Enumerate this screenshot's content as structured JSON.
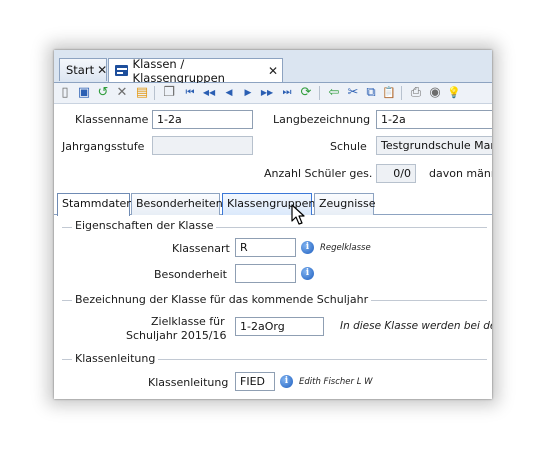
{
  "tabs": [
    {
      "label": "Start",
      "close": "✕"
    },
    {
      "label": "Klassen / Klassengruppen",
      "close": "✕"
    }
  ],
  "toolbar": [
    {
      "name": "new-icon",
      "glyph": "▯"
    },
    {
      "name": "save-icon",
      "glyph": "▣"
    },
    {
      "name": "undo-icon",
      "glyph": "↺"
    },
    {
      "name": "delete-icon",
      "glyph": "✕"
    },
    {
      "name": "form-icon",
      "glyph": "▤"
    },
    {
      "name": "copy-icon",
      "glyph": "❐"
    },
    {
      "name": "first-icon",
      "glyph": "⏮"
    },
    {
      "name": "prev-page-icon",
      "glyph": "◀◀"
    },
    {
      "name": "prev-icon",
      "glyph": "◀"
    },
    {
      "name": "next-icon",
      "glyph": "▶"
    },
    {
      "name": "next-page-icon",
      "glyph": "▶▶"
    },
    {
      "name": "last-icon",
      "glyph": "⏭"
    },
    {
      "name": "refresh-icon",
      "glyph": "⟳"
    },
    {
      "name": "back-arrow-icon",
      "glyph": "⇦"
    },
    {
      "name": "cut-icon",
      "glyph": "✂"
    },
    {
      "name": "copy2-icon",
      "glyph": "⧉"
    },
    {
      "name": "paste-icon",
      "glyph": "📋"
    },
    {
      "name": "print-icon",
      "glyph": "⎙"
    },
    {
      "name": "view-icon",
      "glyph": "◉"
    },
    {
      "name": "idea-icon",
      "glyph": "💡"
    }
  ],
  "form": {
    "klassenname_label": "Klassenname",
    "klassenname_value": "1-2a",
    "langbezeichnung_label": "Langbezeichnung",
    "langbezeichnung_value": "1-2a",
    "jahrgangsstufe_label": "Jahrgangsstufe",
    "jahrgangsstufe_value": "",
    "schule_label": "Schule",
    "schule_value": "Testgrundschule Mark",
    "anzahl_label": "Anzahl Schüler ges.",
    "anzahl_value": "0/0",
    "davon_label": "davon männ"
  },
  "inner_tabs": [
    "Stammdaten",
    "Besonderheiten",
    "Klassengruppen",
    "Zeugnisse"
  ],
  "eigenschaften": {
    "title": "Eigenschaften der Klasse",
    "klassenart_label": "Klassenart",
    "klassenart_value": "R",
    "klassenart_hint": "Regelklasse",
    "besonderheit_label": "Besonderheit",
    "besonderheit_value": ""
  },
  "bezeichnung": {
    "title": "Bezeichnung der Klasse für das kommende Schuljahr",
    "zielklasse_label_1": "Zielklasse für",
    "zielklasse_label_2": "Schuljahr 2015/16",
    "zielklasse_value": "1-2aOrg",
    "hint": "In diese Klasse werden bei der i"
  },
  "klassenleitung": {
    "title": "Klassenleitung",
    "label": "Klassenleitung",
    "value": "FIED",
    "hint": "Edith Fischer L W"
  },
  "colors": {
    "accent": "#1e4f9c",
    "tab_border": "#8da3c1",
    "toolbar_bg": "#eef2f8"
  }
}
